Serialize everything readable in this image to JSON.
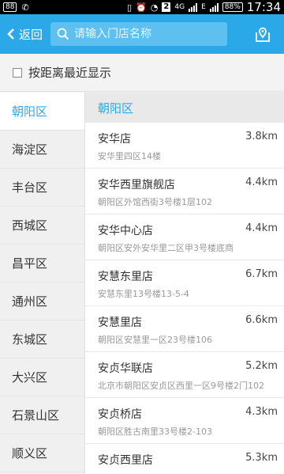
{
  "status_bar": {
    "notif_badge": "88",
    "sim_badge": "2",
    "network": "4G",
    "network2": "E",
    "battery": "88%",
    "time": "17:34"
  },
  "header": {
    "back_label": "返回",
    "search_placeholder": "请输入门店名称"
  },
  "sort": {
    "label": "按距离最近显示",
    "checked": false
  },
  "districts": [
    "朝阳区",
    "海淀区",
    "丰台区",
    "西城区",
    "昌平区",
    "通州区",
    "东城区",
    "大兴区",
    "石景山区",
    "顺义区"
  ],
  "active_district": "朝阳区",
  "section_title": "朝阳区",
  "stores": [
    {
      "name": "安华店",
      "distance": "3.8km",
      "address": "安华里四区14楼"
    },
    {
      "name": "安华西里旗舰店",
      "distance": "4.4km",
      "address": "朝阳区外馆西街3号楼1层102"
    },
    {
      "name": "安华中心店",
      "distance": "4.4km",
      "address": "朝阳区安外安华里二区甲3号楼底商"
    },
    {
      "name": "安慧东里店",
      "distance": "6.7km",
      "address": "安慧东里13号楼13-5-4"
    },
    {
      "name": "安慧里店",
      "distance": "6.6km",
      "address": "朝阳区安慧里一区23号楼106"
    },
    {
      "name": "安贞华联店",
      "distance": "5.2km",
      "address": "北京市朝阳区安贞区西里一区9号楼2门102"
    },
    {
      "name": "安贞桥店",
      "distance": "4.3km",
      "address": "朝阳区胜古南里33号楼2-103"
    },
    {
      "name": "安贞西里店",
      "distance": "5.3km",
      "address": ""
    }
  ],
  "colors": {
    "accent": "#2aa8e8",
    "active_text": "#2aa8e8"
  }
}
